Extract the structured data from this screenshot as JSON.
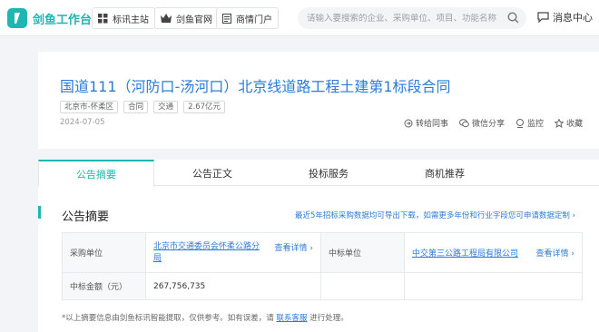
{
  "topbar": {
    "logo_text": "剑鱼工作台",
    "nav": [
      {
        "label": "标讯主站",
        "icon": "grid-icon"
      },
      {
        "label": "剑鱼官网",
        "icon": "crown-icon"
      },
      {
        "label": "商情门户",
        "icon": "document-icon"
      }
    ],
    "search_placeholder": "请输入要搜索的企业、采购单位、项目、功能名称",
    "message_label": "消息中心"
  },
  "header": {
    "title": "国道111（河防口-汤河口）北京线道路工程土建第1标段合同",
    "tags": [
      "北京市-怀柔区",
      "合同",
      "交通",
      "2.67亿元"
    ],
    "date": "2024-07-05",
    "actions": [
      {
        "label": "转给同事",
        "icon": "share-icon"
      },
      {
        "label": "微信分享",
        "icon": "wechat-icon"
      },
      {
        "label": "监控",
        "icon": "monitor-icon"
      },
      {
        "label": "收藏",
        "icon": "star-icon"
      }
    ]
  },
  "tabs": [
    "公告摘要",
    "公告正文",
    "投标服务",
    "商机推荐"
  ],
  "summary": {
    "title": "公告摘要",
    "export_link": "最近5年招标采购数据均可导出下载，如需更多年份和行业字段您可申请数据定制 ›",
    "buyer_label": "采购单位",
    "buyer_value": "北京市交通委员会怀柔公路分局",
    "winner_label": "中标单位",
    "winner_value": "中交第三公路工程局有限公司",
    "detail_label": "查看详情 ›",
    "amount_label": "中标金额（元）",
    "amount_value": "267,756,735",
    "note_prefix": "*以上摘要信息由剑鱼标讯智能提取，仅供参考。如有误差，请",
    "note_link": "联系客服",
    "note_suffix": "进行处理。"
  },
  "colors": {
    "accent": "#1fb5b0",
    "link": "#2c7bd6"
  }
}
